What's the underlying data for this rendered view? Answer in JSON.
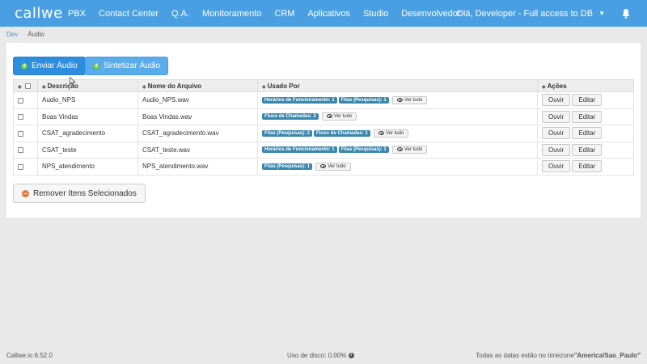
{
  "app": {
    "logo": "callwe"
  },
  "nav": {
    "items": [
      "PBX",
      "Contact Center",
      "Q.A.",
      "Monitoramento",
      "CRM",
      "Aplicativos",
      "Studio",
      "Desenvolvedor"
    ],
    "user": "Olá, Developer - Full access to DB"
  },
  "breadcrumb": {
    "root": "Dev",
    "current": "Áudio"
  },
  "toolbar": {
    "upload_label": "Enviar Áudio",
    "synthesize_label": "Sintetizar Áudio"
  },
  "table": {
    "headers": {
      "description": "Descrição",
      "filename": "Nome do Arquivo",
      "used_by": "Usado Por",
      "actions": "Ações"
    },
    "see_all_label": "Ver tudo",
    "listen_label": "Ouvir",
    "edit_label": "Editar",
    "rows": [
      {
        "description": "Audio_NPS",
        "filename": "Audio_NPS.wav",
        "usage": [
          "Horários de Funcionamento: 1",
          "Filas (Pesquisas): 1"
        ]
      },
      {
        "description": "Boas Vindas",
        "filename": "Boas Vindas.wav",
        "usage": [
          "Fluxo de Chamadas: 2"
        ]
      },
      {
        "description": "CSAT_agradecimento",
        "filename": "CSAT_agradecimento.wav",
        "usage": [
          "Filas (Pesquisas): 2",
          "Fluxo de Chamadas: 1"
        ]
      },
      {
        "description": "CSAT_teste",
        "filename": "CSAT_teste.wav",
        "usage": [
          "Horários de Funcionamento: 1",
          "Filas (Pesquisas): 1"
        ]
      },
      {
        "description": "NPS_atendimento",
        "filename": "NPS_atendimento.wav",
        "usage": [
          "Filas (Pesquisas): 1"
        ]
      }
    ]
  },
  "remove_label": "Remover Itens Selecionados",
  "footer": {
    "version": "Callwe.io 6.52.0",
    "disk_usage": "Uso de disco: 0.00%",
    "timezone_prefix": "Todas as datas estão no timezone",
    "timezone": "\"America/Sao_Paulo\""
  },
  "colors": {
    "navbar": "#4a9fe3",
    "primary": "#2d8ee0",
    "badge": "#3a87ad"
  },
  "icons": {
    "bell": "bell-icon",
    "eye": "eye-icon",
    "remove": "remove-icon",
    "info": "info-icon"
  }
}
